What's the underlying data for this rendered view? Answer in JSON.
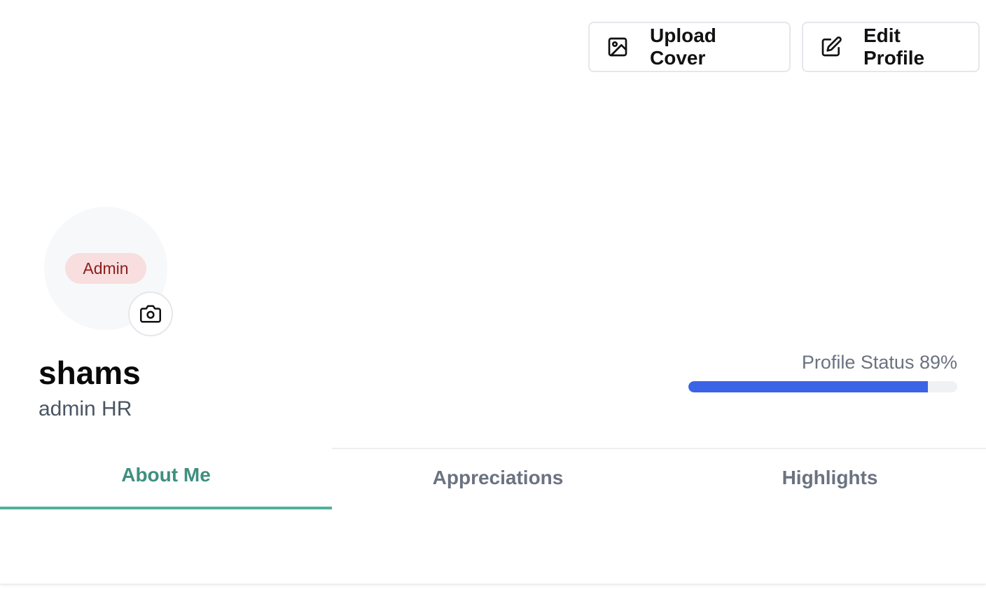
{
  "actions": {
    "upload_cover_label": "Upload Cover",
    "edit_profile_label": "Edit Profile",
    "upload_icon": "image-icon",
    "edit_icon": "edit-pencil-icon"
  },
  "profile": {
    "role_badge": "Admin",
    "name": "shams",
    "title": "admin HR",
    "camera_icon": "camera-icon"
  },
  "status": {
    "label": "Profile Status 89%",
    "progress_percent": 89
  },
  "tabs": [
    {
      "label": "About Me",
      "active": true
    },
    {
      "label": "Appreciations",
      "active": false
    },
    {
      "label": "Highlights",
      "active": false
    }
  ],
  "colors": {
    "accent_teal": "#52b0a0",
    "progress_blue": "#3b63e6",
    "badge_bg": "#f8dede",
    "badge_text": "#8b1d1d"
  }
}
